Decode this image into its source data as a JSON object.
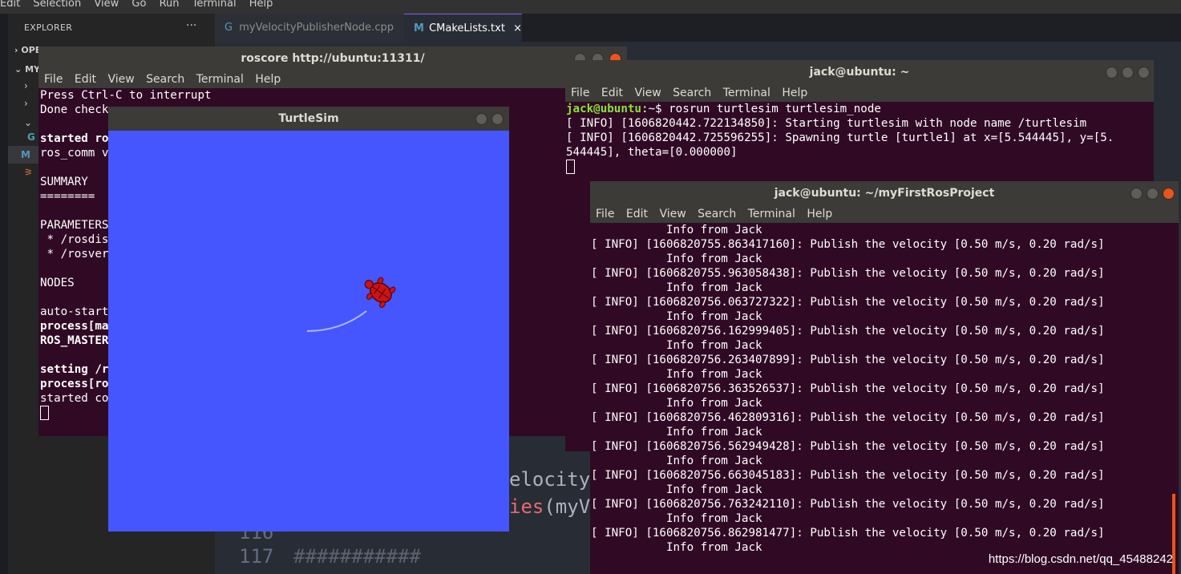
{
  "vscode": {
    "menu": [
      "Edit",
      "Selection",
      "View",
      "Go",
      "Run",
      "Terminal",
      "Help"
    ],
    "explorer_title": "EXPLORER",
    "explorer_more": "···",
    "tree": [
      "OPE",
      "MYF"
    ],
    "tabs": [
      {
        "label": "myVelocityPublisherNode.cpp",
        "icon": "cpp-file-icon"
      },
      {
        "label": "CMakeLists.txt",
        "icon": "cmake-file-icon",
        "close": "×"
      }
    ],
    "code": {
      "line_a_text": "elocityP",
      "line_b_text": "ies(myVe",
      "line_num_116": "116",
      "line_num_117": "117",
      "line_117_text": "###########"
    }
  },
  "roscore": {
    "title": "roscore http://ubuntu:11311/",
    "menu": [
      "File",
      "Edit",
      "View",
      "Search",
      "Terminal",
      "Help"
    ],
    "lines": {
      "l1": "Press Ctrl-C to interrupt",
      "l2": "Done check",
      "l3": "started ro",
      "l4": "ros_comm v",
      "l5": "SUMMARY",
      "l6": "========",
      "l7": "PARAMETERS",
      "l8": " * /rosdis",
      "l9": " * /rosver",
      "l10": "NODES",
      "l11": "auto-start",
      "l12": "process[ma",
      "l13": "ROS_MASTER",
      "l14": "setting /r",
      "l15": "process[ro",
      "l16": "started co"
    }
  },
  "turtlesim": {
    "title": "TurtleSim",
    "background": "#4556ff"
  },
  "turtle_node": {
    "title": "jack@ubuntu: ~",
    "menu": [
      "File",
      "Edit",
      "View",
      "Search",
      "Terminal",
      "Help"
    ],
    "prompt_user": "jack@ubuntu",
    "prompt_path": ":~$ ",
    "command": "rosrun turtlesim turtlesim_node",
    "lines": [
      "[ INFO] [1606820442.722134850]: Starting turtlesim with node name /turtlesim",
      "[ INFO] [1606820442.725596255]: Spawning turtle [turtle1] at x=[5.544445], y=[5.",
      "544445], theta=[0.000000]"
    ]
  },
  "publisher": {
    "title": "jack@ubuntu: ~/myFirstRosProject",
    "menu": [
      "File",
      "Edit",
      "View",
      "Search",
      "Terminal",
      "Help"
    ],
    "info_line": "           Info from Jack",
    "entries": [
      "[ INFO] [1606820755.863417160]: Publish the velocity [0.50 m/s, 0.20 rad/s]",
      "[ INFO] [1606820755.963058438]: Publish the velocity [0.50 m/s, 0.20 rad/s]",
      "[ INFO] [1606820756.063727322]: Publish the velocity [0.50 m/s, 0.20 rad/s]",
      "[ INFO] [1606820756.162999405]: Publish the velocity [0.50 m/s, 0.20 rad/s]",
      "[ INFO] [1606820756.263407899]: Publish the velocity [0.50 m/s, 0.20 rad/s]",
      "[ INFO] [1606820756.363526537]: Publish the velocity [0.50 m/s, 0.20 rad/s]",
      "[ INFO] [1606820756.462809316]: Publish the velocity [0.50 m/s, 0.20 rad/s]",
      "[ INFO] [1606820756.562949428]: Publish the velocity [0.50 m/s, 0.20 rad/s]",
      "[ INFO] [1606820756.663045183]: Publish the velocity [0.50 m/s, 0.20 rad/s]",
      "[ INFO] [1606820756.763242110]: Publish the velocity [0.50 m/s, 0.20 rad/s]",
      "[ INFO] [1606820756.862981477]: Publish the velocity [0.50 m/s, 0.20 rad/s]"
    ]
  },
  "watermark": "https://blog.csdn.net/qq_45488242"
}
